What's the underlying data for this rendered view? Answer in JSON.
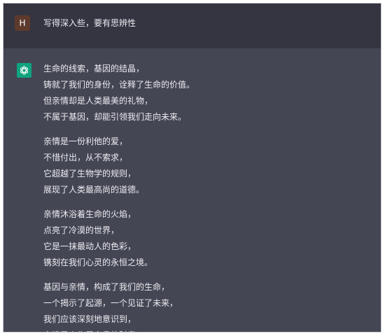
{
  "conversation": {
    "user": {
      "avatar_letter": "H",
      "message": "写得深入些，要有思辨性"
    },
    "assistant": {
      "avatar_icon": "chatgpt-logo-icon",
      "stanzas": [
        [
          "生命的线索，基因的结晶，",
          "铸就了我们的身份，诠释了生命的价值。",
          "但亲情却是人类最美的礼物，",
          "不属于基因，却能引领我们走向未来。"
        ],
        [
          "亲情是一份利他的爱，",
          "不惜付出，从不索求，",
          "它超越了生物学的规则，",
          "展现了人类最高尚的道德。"
        ],
        [
          "亲情沐浴着生命的火焰，",
          "点亮了冷漠的世界，",
          "它是一抹最动人的色彩，",
          "镌刻在我们心灵的永恒之境。"
        ],
        [
          "基因与亲情，构成了我们的生命，",
          "一个揭示了起源，一个见证了未来，",
          "我们应该深刻地意识到，",
          "亲情是人生最宝贵的财富。"
        ]
      ]
    }
  },
  "colors": {
    "user_row_bg": "#343541",
    "assistant_row_bg": "#444654",
    "user_avatar_bg": "#5d3a2c",
    "gpt_avatar_bg": "#10a37f",
    "text": "#ececf1"
  }
}
